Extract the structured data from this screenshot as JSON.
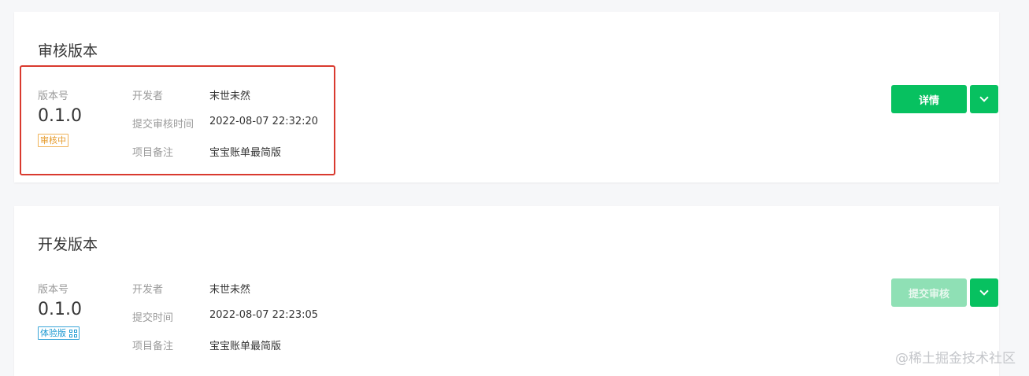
{
  "review_card": {
    "title": "审核版本",
    "version_label": "版本号",
    "version": "0.1.0",
    "status_tag": "审核中",
    "developer_label": "开发者",
    "developer": "末世未然",
    "submit_time_label": "提交审核时间",
    "submit_time": "2022-08-07 22:32:20",
    "remark_label": "项目备注",
    "remark": "宝宝账单最简版",
    "detail_button": "详情"
  },
  "dev_card": {
    "title": "开发版本",
    "version_label": "版本号",
    "version": "0.1.0",
    "status_tag": "体验版",
    "developer_label": "开发者",
    "developer": "末世未然",
    "submit_time_label": "提交时间",
    "submit_time": "2022-08-07 22:23:05",
    "remark_label": "项目备注",
    "remark": "宝宝账单最简版",
    "submit_review_button": "提交审核"
  },
  "watermark": "@稀土掘金技术社区",
  "colors": {
    "primary_green": "#07c160",
    "disabled_green": "#8fe0b5",
    "review_tag": "#e69b2d",
    "trial_tag": "#1e9ad2",
    "highlight_red": "#d93a2f"
  }
}
